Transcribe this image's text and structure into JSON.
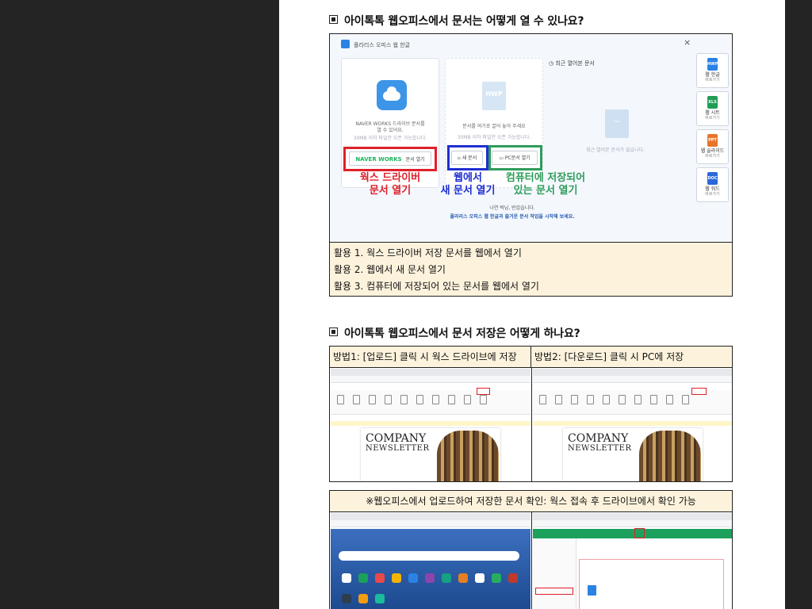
{
  "section1": {
    "heading": "아이톡톡 웹오피스에서 문서는 어떻게 열 수 있나요?",
    "screenshot": {
      "window_title": "폴라리스 오피스 웹 한글",
      "close_icon": "×",
      "naver_card": {
        "text_line1": "NAVER WORKS 드라이브 문서를",
        "text_line2": "열 수 있어요.",
        "text_line3": "30MB 이하 파일만 오픈 가능합니다.",
        "logo": "NAVER WORKS",
        "button": "문서 열기"
      },
      "drop_card": {
        "file_icon": "HWP",
        "text_line1": "문서를 여기로 끌어 놓아 주세요",
        "text_line2": "30MB 이하 파일만 오픈 가능합니다.",
        "new_button": "새 문서",
        "pc_button": "PC문서 열기"
      },
      "recent": {
        "title": "최근 열어본 문서",
        "empty": "최근 열어본 문서가 없습니다."
      },
      "greeting_line1": "나연 박님, 반갑습니다.",
      "greeting_line2": "폴라리스 오피스 웹 한글과 즐거운 문서 작업을 시작해 보세요.",
      "annotations": {
        "red_line1": "웍스 드라이버",
        "red_line2": "문서 열기",
        "blue_line1": "웹에서",
        "blue_line2": "새 문서 열기",
        "green_line1": "컴퓨터에 저장되어",
        "green_line2": "있는 문서 열기"
      },
      "side_tabs": [
        {
          "icon": "HWP",
          "name": "웹 한글",
          "sub": "바로가기",
          "color": "#2a82e4"
        },
        {
          "icon": "XLS",
          "name": "웹 시트",
          "sub": "바로가기",
          "color": "#1f9d55"
        },
        {
          "icon": "PPT",
          "name": "웹 슬라이드",
          "sub": "바로가기",
          "color": "#e8742a"
        },
        {
          "icon": "DOC",
          "name": "웹 워드",
          "sub": "바로가기",
          "color": "#2a68d8"
        }
      ]
    },
    "notes": [
      "활용 1. 웍스 드라이버 저장 문서를 웹에서 열기",
      "활용 2. 웹에서 새 문서 열기",
      "활용 3. 컴퓨터에 저장되어 있는 문서를 웹에서 열기"
    ]
  },
  "section2": {
    "heading": "아이톡톡 웹오피스에서 문서 저장은 어떻게 하나요?",
    "method1": "방법1: [업로드] 클릭 시 웍스 드라이브에 저장",
    "method2": "방법2: [다운로드] 클릭 시 PC에 저장",
    "newsletter_title": "COMPANY",
    "newsletter_sub": "NEWSLETTER"
  },
  "section3": {
    "caption": "※웹오피스에서 업로드하여 저장한 문서 확인: 웍스 접속 후 드라이브에서 확인 가능"
  }
}
